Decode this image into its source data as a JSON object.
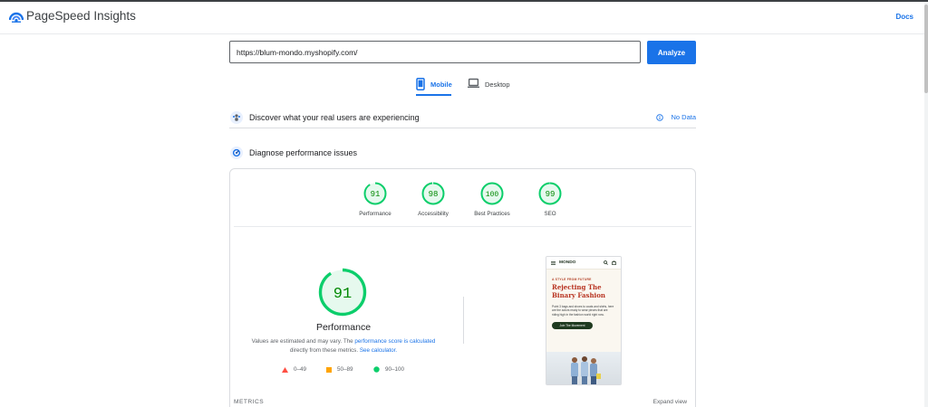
{
  "header": {
    "title": "PageSpeed Insights",
    "docs_label": "Docs",
    "accent": "#1a73e8"
  },
  "search": {
    "url_value": "https://blum-mondo.myshopify.com/",
    "analyze_label": "Analyze"
  },
  "tabs": [
    {
      "label": "Mobile",
      "icon": "mobile-icon",
      "selected": true
    },
    {
      "label": "Desktop",
      "icon": "laptop-icon",
      "selected": false
    }
  ],
  "discover": {
    "title": "Discover what your real users are experiencing",
    "no_data_label": "No Data"
  },
  "diagnose": {
    "title": "Diagnose performance issues"
  },
  "scores": [
    {
      "value": "91",
      "label": "Performance"
    },
    {
      "value": "98",
      "label": "Accessibility"
    },
    {
      "value": "100",
      "label": "Best Practices"
    },
    {
      "value": "99",
      "label": "SEO"
    }
  ],
  "score_fractions": [
    0.91,
    0.98,
    1.0,
    0.99
  ],
  "pass_color": "#0cce6b",
  "pass_text_color": "#008800",
  "main_score": {
    "value": "91",
    "fraction": 0.91,
    "title": "Performance",
    "note_pre": "Values are estimated and may vary. The ",
    "note_link1": "performance score is calculated",
    "note_mid": " directly from these metrics. ",
    "note_link2": "See calculator."
  },
  "legend": [
    {
      "range": "0–49",
      "color": "#ff4e42",
      "shape": "triangle"
    },
    {
      "range": "50–89",
      "color": "#ffa400",
      "shape": "square"
    },
    {
      "range": "90–100",
      "color": "#0cce6b",
      "shape": "circle"
    }
  ],
  "screenshot": {
    "brand": "MONDO",
    "kicker": "A STYLE FROM FUTURE",
    "headline": "Rejecting The Binary Fashion",
    "body": "Point 3 bags and shoes to coats and shirts, here are the actors ready to wear pieces that are riding high in the fashion world right now.",
    "button": "Join The Movement"
  },
  "metrics": {
    "label": "METRICS",
    "expand_label": "Expand view"
  }
}
